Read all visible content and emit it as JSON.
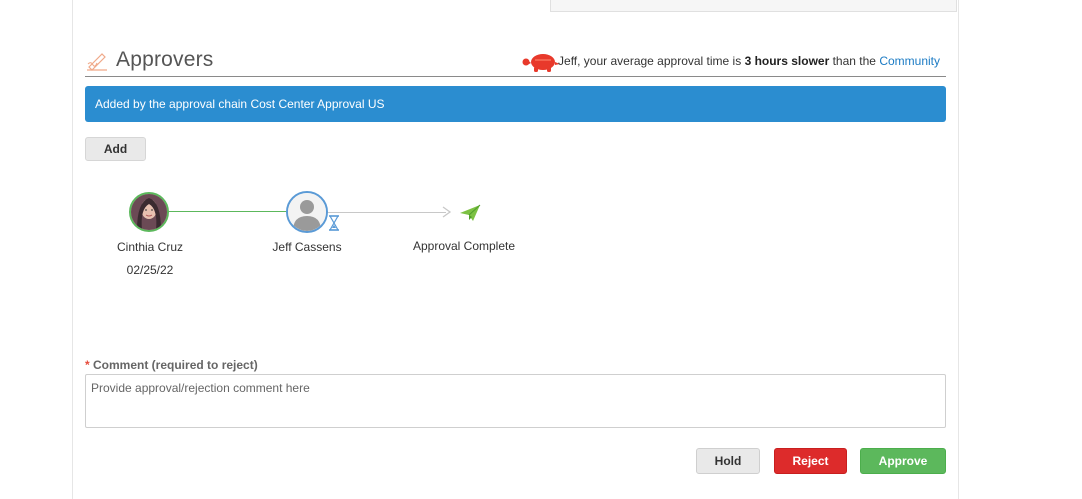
{
  "approvers": {
    "title": "Approvers",
    "avg_prefix": "Jeff, your average approval time is ",
    "avg_bold": "3 hours slower",
    "avg_middle": " than the ",
    "avg_link": "Community"
  },
  "chain_banner": "Added by the approval chain Cost Center Approval US",
  "add_label": "Add",
  "flow": [
    {
      "name": "Cinthia Cruz",
      "date": "02/25/22",
      "status": "approved"
    },
    {
      "name": "Jeff Cassens",
      "status": "pending"
    },
    {
      "name": "Approval Complete"
    }
  ],
  "comment": {
    "required_mark": "* ",
    "label": "Comment (required to reject)",
    "placeholder": "Provide approval/rejection comment here"
  },
  "buttons": {
    "hold": "Hold",
    "reject": "Reject",
    "approve": "Approve"
  },
  "colors": {
    "banner": "#2b8dd0",
    "approve": "#5cb85c",
    "reject": "#dd2b2b",
    "link": "#1b7bc4",
    "turtle": "#e8392b"
  }
}
